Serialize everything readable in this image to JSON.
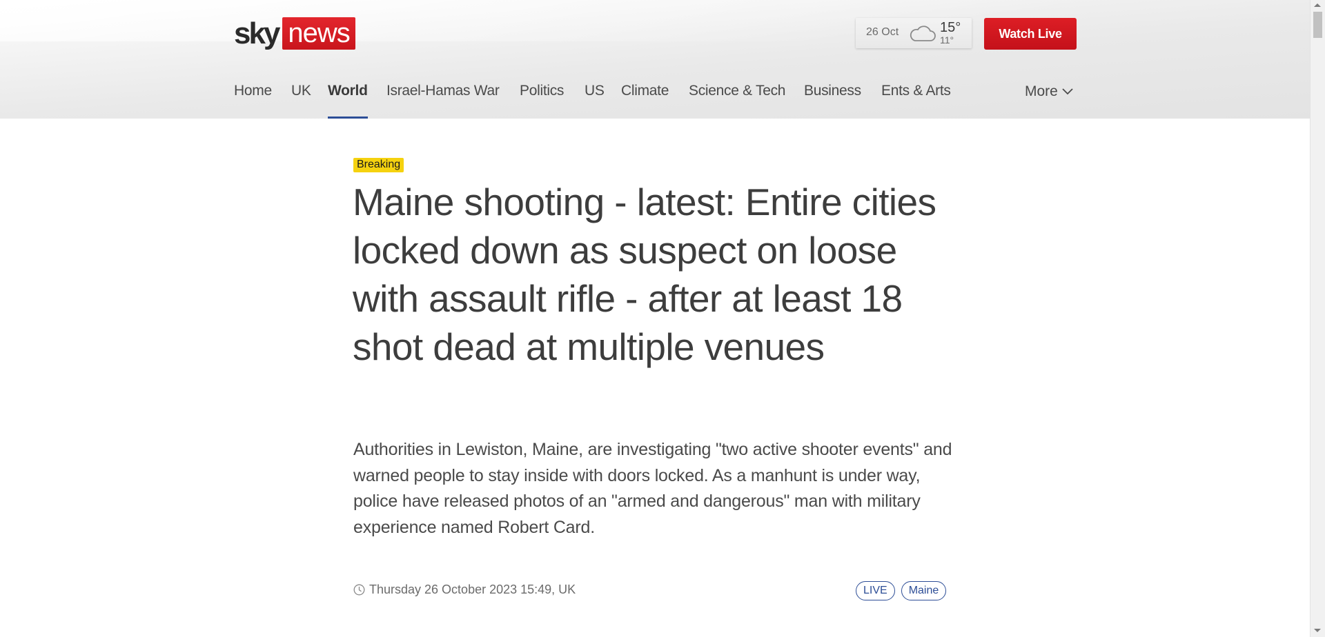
{
  "brand": {
    "sky": "sky",
    "news": "news",
    "accent": "#d8161e"
  },
  "weather": {
    "date": "26 Oct",
    "icon": "cloud-icon",
    "high": "15°",
    "low": "11°"
  },
  "watch_live": {
    "label": "Watch Live"
  },
  "nav": {
    "items": [
      {
        "label": "Home"
      },
      {
        "label": "UK"
      },
      {
        "label": "World"
      },
      {
        "label": "Israel-Hamas War"
      },
      {
        "label": "Politics"
      },
      {
        "label": "US"
      },
      {
        "label": "Climate"
      },
      {
        "label": "Science & Tech"
      },
      {
        "label": "Business"
      },
      {
        "label": "Ents & Arts"
      }
    ],
    "active": "World",
    "more": "More"
  },
  "article": {
    "badge": "Breaking",
    "headline": "Maine shooting - latest: Entire cities locked down as suspect on loose with assault rifle - after at least 18 shot dead at multiple venues",
    "standfirst": "Authorities in Lewiston, Maine, are investigating \"two active shooter events\" and warned people to stay inside with doors locked. As a manhunt is under way, police have released photos of an \"armed and dangerous\" man with military experience named Robert Card.",
    "timestamp": "Thursday 26 October 2023 15:49, UK",
    "tags": [
      {
        "label": "LIVE"
      },
      {
        "label": "Maine"
      }
    ]
  }
}
